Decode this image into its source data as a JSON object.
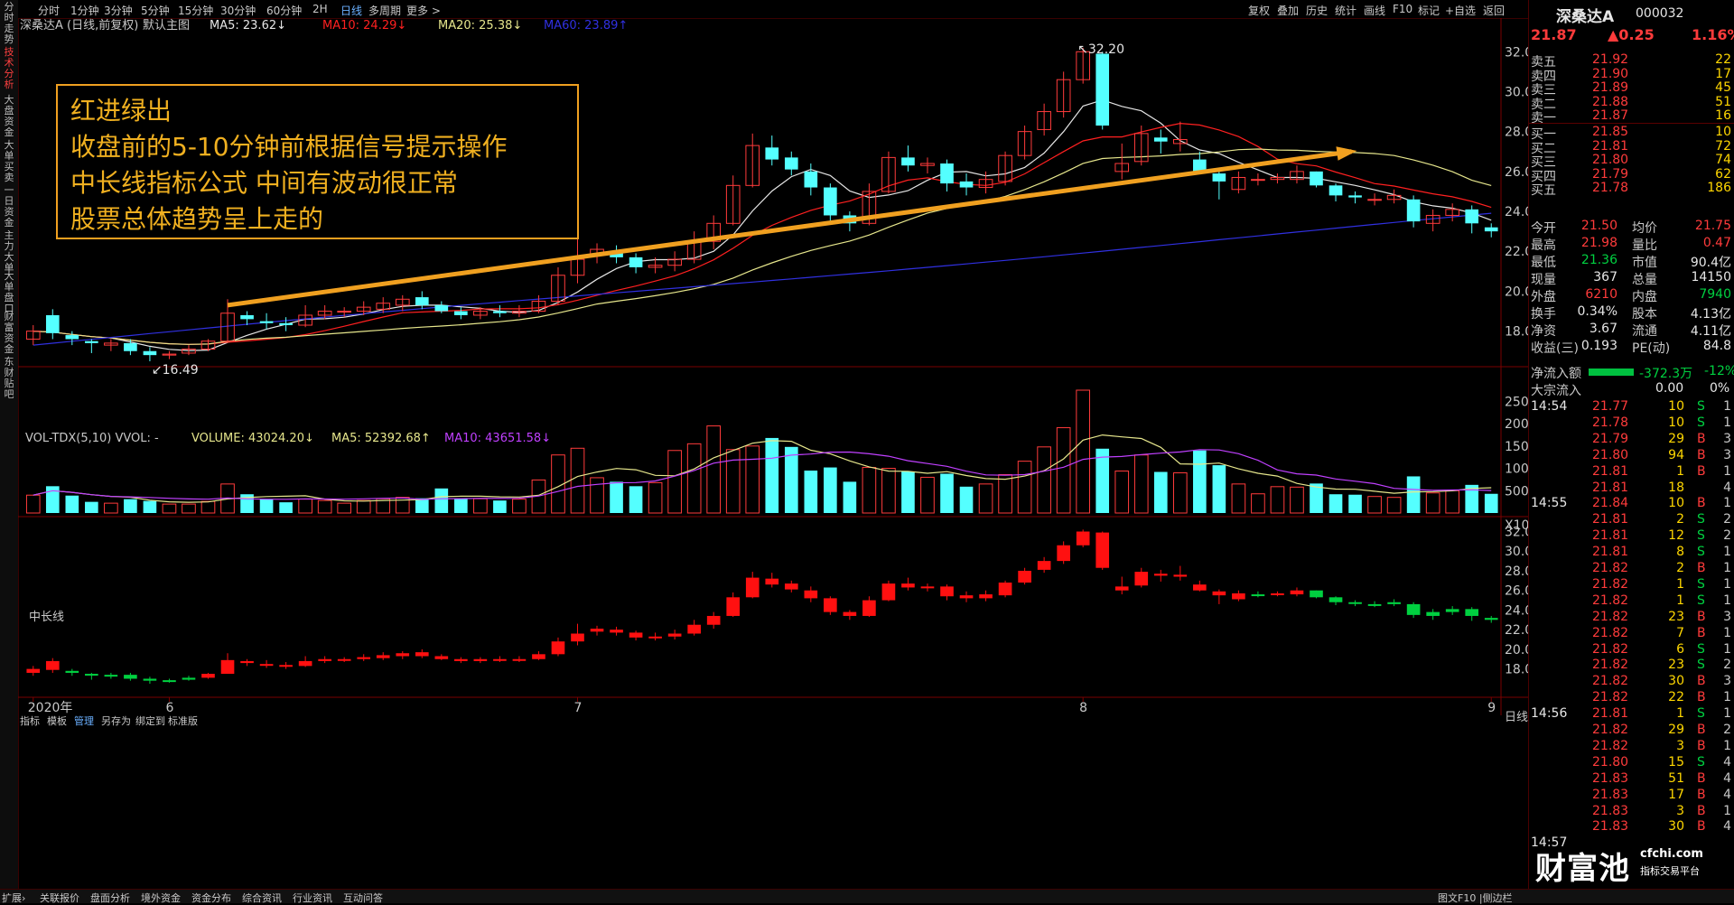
{
  "left_tabs": [
    "分时走势",
    "技术分析",
    "大盘资金",
    "大单买卖",
    "一日资金",
    "主力大单",
    "大单盘口",
    "财富资金",
    "东财贴吧"
  ],
  "period_tabs": [
    "分时",
    "1分钟",
    "3分钟",
    "5分钟",
    "15分钟",
    "30分钟",
    "60分钟",
    "2H",
    "日线",
    "多周期",
    "更多 >"
  ],
  "active_period": "日线",
  "toolbar_right": [
    "复权",
    "叠加",
    "历史",
    "统计",
    "画线",
    "F10",
    "标记",
    "+自选",
    "返回"
  ],
  "main_legend": {
    "stock": "深桑达A (日线,前复权)",
    "mode": "默认主图",
    "ma5": "MA5: 23.62↓",
    "ma10": "MA10: 24.29↓",
    "ma20": "MA20: 25.38↓",
    "ma60": "MA60: 23.89↑"
  },
  "vol_legend": {
    "name": "VOL-TDX(5,10) VVOL: -",
    "volume": "VOLUME: 43024.20↓",
    "ma5": "MA5: 52392.68↑",
    "ma10": "MA10: 43651.58↓"
  },
  "ind_legend": "中长线",
  "annotation": [
    "红进绿出",
    "收盘前的5-10分钟前根据信号提示操作",
    "中长线指标公式  中间有波动很正常",
    "股票总体趋势呈上走的"
  ],
  "price_ticks": [
    "32.00",
    "30.00",
    "28.00",
    "26.00",
    "24.00",
    "22.00",
    "20.00",
    "18.00"
  ],
  "vol_ticks": [
    "25000",
    "20000",
    "15000",
    "10000",
    "5000",
    "X10"
  ],
  "ind_ticks": [
    "32.00",
    "30.00",
    "28.00",
    "26.00",
    "24.00",
    "22.00",
    "20.00",
    "18.00"
  ],
  "x_labels": [
    "2020年",
    "6",
    "7",
    "8",
    "9"
  ],
  "high_label": "32.20",
  "low_label": "16.49",
  "quote": {
    "name": "深桑达A",
    "code": "000032",
    "price": "21.87",
    "change": "▲0.25",
    "pct": "1.16%",
    "asks": [
      {
        "l": "卖五",
        "p": "21.92",
        "v": "22"
      },
      {
        "l": "卖四",
        "p": "21.90",
        "v": "17"
      },
      {
        "l": "卖三",
        "p": "21.89",
        "v": "45"
      },
      {
        "l": "卖二",
        "p": "21.88",
        "v": "51"
      },
      {
        "l": "卖一",
        "p": "21.87",
        "v": "16"
      }
    ],
    "bids": [
      {
        "l": "买一",
        "p": "21.85",
        "v": "10"
      },
      {
        "l": "买二",
        "p": "21.81",
        "v": "72"
      },
      {
        "l": "买三",
        "p": "21.80",
        "v": "74"
      },
      {
        "l": "买四",
        "p": "21.79",
        "v": "62"
      },
      {
        "l": "买五",
        "p": "21.78",
        "v": "186"
      }
    ],
    "stats": [
      [
        "今开",
        "21.50",
        "均价",
        "21.75"
      ],
      [
        "最高",
        "21.98",
        "量比",
        "0.47"
      ],
      [
        "最低",
        "21.36",
        "市值",
        "90.4亿"
      ],
      [
        "现量",
        "367",
        "总量",
        "14150"
      ],
      [
        "外盘",
        "6210",
        "内盘",
        "7940"
      ],
      [
        "换手",
        "0.34%",
        "股本",
        "4.13亿"
      ],
      [
        "净资",
        "3.67",
        "流通",
        "4.11亿"
      ],
      [
        "收益(三)",
        "0.193",
        "PE(动)",
        "84.8"
      ]
    ],
    "netflow_label": "净流入额",
    "netflow_val": "-372.3万",
    "netflow_pct": "-12%",
    "block_label": "大宗流入",
    "block_val": "0.00",
    "block_pct": "0%"
  },
  "ticks": [
    {
      "t": "14:54",
      "p": "21.77",
      "v": "10",
      "s": "S",
      "n": "1"
    },
    {
      "t": "",
      "p": "21.78",
      "v": "10",
      "s": "S",
      "n": "1"
    },
    {
      "t": "",
      "p": "21.79",
      "v": "29",
      "s": "B",
      "n": "3"
    },
    {
      "t": "",
      "p": "21.80",
      "v": "94",
      "s": "B",
      "n": "3"
    },
    {
      "t": "",
      "p": "21.81",
      "v": "1",
      "s": "B",
      "n": "1"
    },
    {
      "t": "",
      "p": "21.81",
      "v": "18",
      "s": "",
      "n": "4"
    },
    {
      "t": "14:55",
      "p": "21.84",
      "v": "10",
      "s": "B",
      "n": "1"
    },
    {
      "t": "",
      "p": "21.81",
      "v": "2",
      "s": "S",
      "n": "2"
    },
    {
      "t": "",
      "p": "21.81",
      "v": "12",
      "s": "S",
      "n": "2"
    },
    {
      "t": "",
      "p": "21.81",
      "v": "8",
      "s": "S",
      "n": "1"
    },
    {
      "t": "",
      "p": "21.82",
      "v": "2",
      "s": "B",
      "n": "1"
    },
    {
      "t": "",
      "p": "21.82",
      "v": "1",
      "s": "S",
      "n": "1"
    },
    {
      "t": "",
      "p": "21.82",
      "v": "1",
      "s": "S",
      "n": "1"
    },
    {
      "t": "",
      "p": "21.82",
      "v": "23",
      "s": "B",
      "n": "3"
    },
    {
      "t": "",
      "p": "21.82",
      "v": "7",
      "s": "B",
      "n": "1"
    },
    {
      "t": "",
      "p": "21.82",
      "v": "6",
      "s": "S",
      "n": "1"
    },
    {
      "t": "",
      "p": "21.82",
      "v": "23",
      "s": "S",
      "n": "2"
    },
    {
      "t": "",
      "p": "21.82",
      "v": "30",
      "s": "B",
      "n": "3"
    },
    {
      "t": "",
      "p": "21.82",
      "v": "22",
      "s": "B",
      "n": "1"
    },
    {
      "t": "14:56",
      "p": "21.81",
      "v": "1",
      "s": "S",
      "n": "1"
    },
    {
      "t": "",
      "p": "21.82",
      "v": "29",
      "s": "B",
      "n": "2"
    },
    {
      "t": "",
      "p": "21.82",
      "v": "3",
      "s": "B",
      "n": "1"
    },
    {
      "t": "",
      "p": "21.80",
      "v": "15",
      "s": "S",
      "n": "4"
    },
    {
      "t": "",
      "p": "21.83",
      "v": "51",
      "s": "B",
      "n": "4"
    },
    {
      "t": "",
      "p": "21.83",
      "v": "17",
      "s": "B",
      "n": "4"
    },
    {
      "t": "",
      "p": "21.83",
      "v": "3",
      "s": "B",
      "n": "1"
    },
    {
      "t": "",
      "p": "21.83",
      "v": "30",
      "s": "B",
      "n": "4"
    },
    {
      "t": "14:57",
      "p": "",
      "v": "",
      "s": "",
      "n": ""
    }
  ],
  "bottom_left": [
    "指标",
    "模板",
    "管理",
    "另存为",
    "绑定到",
    "标准版"
  ],
  "bottom_status": [
    "扩展›",
    "关联报价",
    "盘面分析",
    "境外资金",
    "资金分布",
    "综合资讯",
    "行业资讯",
    "互动问答"
  ],
  "bottom_right_tab": "日线",
  "bottom_right_misc": "图文F10 |侧边栏",
  "logo": {
    "big": "财富池",
    "url": "cfchi.com",
    "sub": "指标交易平台"
  },
  "colors": {
    "up": "#ff3b3b",
    "down": "#54ffff",
    "ma5": "#e6e6e6",
    "ma10": "#ff2020",
    "ma20": "#e6e68c",
    "ma60": "#3030e0",
    "vol_ma5": "#e6e68c",
    "vol_ma10": "#c040ff",
    "ind_up": "#ff1010",
    "ind_down": "#00d040",
    "arrow": "#f0a020"
  },
  "chart_data": {
    "type": "candlestick",
    "title": "深桑达A (日线,前复权)",
    "series": [
      {
        "o": 17.6,
        "c": 18.0,
        "h": 18.3,
        "l": 17.3,
        "v": 4000
      },
      {
        "o": 18.8,
        "c": 17.9,
        "h": 19.1,
        "l": 17.6,
        "v": 6000
      },
      {
        "o": 17.8,
        "c": 17.6,
        "h": 18.0,
        "l": 17.3,
        "v": 3900
      },
      {
        "o": 17.5,
        "c": 17.4,
        "h": 17.6,
        "l": 16.9,
        "v": 2500
      },
      {
        "o": 17.3,
        "c": 17.4,
        "h": 17.6,
        "l": 17.0,
        "v": 2200
      },
      {
        "o": 17.4,
        "c": 17.0,
        "h": 17.6,
        "l": 16.8,
        "v": 3100
      },
      {
        "o": 17.0,
        "c": 16.8,
        "h": 17.2,
        "l": 16.49,
        "v": 2700
      },
      {
        "o": 16.8,
        "c": 16.85,
        "h": 17.0,
        "l": 16.6,
        "v": 2000
      },
      {
        "o": 16.9,
        "c": 17.1,
        "h": 17.3,
        "l": 16.8,
        "v": 2000
      },
      {
        "o": 17.1,
        "c": 17.5,
        "h": 17.6,
        "l": 17.0,
        "v": 2600
      },
      {
        "o": 17.5,
        "c": 18.9,
        "h": 19.6,
        "l": 17.5,
        "v": 6500
      },
      {
        "o": 18.8,
        "c": 18.6,
        "h": 19.0,
        "l": 18.3,
        "v": 4200
      },
      {
        "o": 18.5,
        "c": 18.4,
        "h": 18.9,
        "l": 18.1,
        "v": 3100
      },
      {
        "o": 18.4,
        "c": 18.3,
        "h": 18.7,
        "l": 18.0,
        "v": 2400
      },
      {
        "o": 18.3,
        "c": 18.8,
        "h": 19.3,
        "l": 18.2,
        "v": 3100
      },
      {
        "o": 18.8,
        "c": 19.0,
        "h": 19.3,
        "l": 18.6,
        "v": 2800
      },
      {
        "o": 19.0,
        "c": 19.0,
        "h": 19.2,
        "l": 18.7,
        "v": 2200
      },
      {
        "o": 19.0,
        "c": 19.2,
        "h": 19.5,
        "l": 18.8,
        "v": 2800
      },
      {
        "o": 19.1,
        "c": 19.4,
        "h": 19.7,
        "l": 18.9,
        "v": 3200
      },
      {
        "o": 19.3,
        "c": 19.6,
        "h": 19.8,
        "l": 19.0,
        "v": 3500
      },
      {
        "o": 19.7,
        "c": 19.3,
        "h": 20.0,
        "l": 19.1,
        "v": 3300
      },
      {
        "o": 19.3,
        "c": 19.0,
        "h": 19.5,
        "l": 18.9,
        "v": 5500
      },
      {
        "o": 19.0,
        "c": 18.8,
        "h": 19.2,
        "l": 18.6,
        "v": 3300
      },
      {
        "o": 18.8,
        "c": 19.0,
        "h": 19.2,
        "l": 18.6,
        "v": 3200
      },
      {
        "o": 19.0,
        "c": 18.9,
        "h": 19.3,
        "l": 18.7,
        "v": 2800
      },
      {
        "o": 18.9,
        "c": 19.0,
        "h": 19.3,
        "l": 18.7,
        "v": 3100
      },
      {
        "o": 19.0,
        "c": 19.5,
        "h": 19.8,
        "l": 18.9,
        "v": 7400
      },
      {
        "o": 19.5,
        "c": 20.8,
        "h": 21.2,
        "l": 19.3,
        "v": 13000
      },
      {
        "o": 20.8,
        "c": 21.6,
        "h": 22.6,
        "l": 20.4,
        "v": 14500
      },
      {
        "o": 21.8,
        "c": 22.1,
        "h": 22.4,
        "l": 21.4,
        "v": 7900
      },
      {
        "o": 22.0,
        "c": 21.7,
        "h": 22.3,
        "l": 21.4,
        "v": 7000
      },
      {
        "o": 21.7,
        "c": 21.2,
        "h": 21.9,
        "l": 20.9,
        "v": 6000
      },
      {
        "o": 21.2,
        "c": 21.3,
        "h": 21.7,
        "l": 20.9,
        "v": 6800
      },
      {
        "o": 21.3,
        "c": 21.6,
        "h": 22.0,
        "l": 21.0,
        "v": 14000
      },
      {
        "o": 21.6,
        "c": 22.5,
        "h": 23.0,
        "l": 21.4,
        "v": 15500
      },
      {
        "o": 22.5,
        "c": 23.4,
        "h": 23.8,
        "l": 22.1,
        "v": 19500
      },
      {
        "o": 23.4,
        "c": 25.3,
        "h": 25.8,
        "l": 23.3,
        "v": 14200
      },
      {
        "o": 25.3,
        "c": 27.3,
        "h": 27.9,
        "l": 25.2,
        "v": 15000
      },
      {
        "o": 27.2,
        "c": 26.6,
        "h": 27.8,
        "l": 26.3,
        "v": 16800
      },
      {
        "o": 26.7,
        "c": 26.1,
        "h": 27.0,
        "l": 25.8,
        "v": 14800
      },
      {
        "o": 26.0,
        "c": 25.2,
        "h": 26.4,
        "l": 24.8,
        "v": 9500
      },
      {
        "o": 25.2,
        "c": 23.8,
        "h": 25.4,
        "l": 23.5,
        "v": 10200
      },
      {
        "o": 23.8,
        "c": 23.4,
        "h": 24.0,
        "l": 23.0,
        "v": 7000
      },
      {
        "o": 23.4,
        "c": 25.0,
        "h": 25.4,
        "l": 23.3,
        "v": 10200
      },
      {
        "o": 25.0,
        "c": 26.7,
        "h": 27.0,
        "l": 24.9,
        "v": 10000
      },
      {
        "o": 26.7,
        "c": 26.3,
        "h": 27.3,
        "l": 26.0,
        "v": 9300
      },
      {
        "o": 26.3,
        "c": 26.4,
        "h": 26.7,
        "l": 25.9,
        "v": 8000
      },
      {
        "o": 26.4,
        "c": 25.4,
        "h": 26.6,
        "l": 25.0,
        "v": 8800
      },
      {
        "o": 25.5,
        "c": 25.2,
        "h": 25.9,
        "l": 24.8,
        "v": 5900
      },
      {
        "o": 25.2,
        "c": 25.6,
        "h": 26.0,
        "l": 24.9,
        "v": 6500
      },
      {
        "o": 25.5,
        "c": 26.8,
        "h": 27.0,
        "l": 25.3,
        "v": 8600
      },
      {
        "o": 26.8,
        "c": 28.0,
        "h": 28.3,
        "l": 26.6,
        "v": 11600
      },
      {
        "o": 28.1,
        "c": 29.0,
        "h": 29.4,
        "l": 27.8,
        "v": 14800
      },
      {
        "o": 29.0,
        "c": 30.6,
        "h": 31.0,
        "l": 28.7,
        "v": 19100
      },
      {
        "o": 30.6,
        "c": 32.0,
        "h": 32.2,
        "l": 30.4,
        "v": 27500
      },
      {
        "o": 31.9,
        "c": 28.3,
        "h": 32.0,
        "l": 28.1,
        "v": 14400
      },
      {
        "o": 26.0,
        "c": 26.4,
        "h": 27.4,
        "l": 25.6,
        "v": 9400
      },
      {
        "o": 26.5,
        "c": 27.9,
        "h": 28.3,
        "l": 26.3,
        "v": 13000
      },
      {
        "o": 27.7,
        "c": 27.5,
        "h": 28.1,
        "l": 26.9,
        "v": 9200
      },
      {
        "o": 27.4,
        "c": 27.6,
        "h": 28.5,
        "l": 27.0,
        "v": 9000
      },
      {
        "o": 26.6,
        "c": 26.0,
        "h": 27.0,
        "l": 25.9,
        "v": 14000
      },
      {
        "o": 25.9,
        "c": 25.5,
        "h": 26.1,
        "l": 24.6,
        "v": 10700
      },
      {
        "o": 25.1,
        "c": 25.7,
        "h": 26.0,
        "l": 24.9,
        "v": 6500
      },
      {
        "o": 25.6,
        "c": 25.6,
        "h": 25.9,
        "l": 25.3,
        "v": 4300
      },
      {
        "o": 25.6,
        "c": 25.7,
        "h": 25.9,
        "l": 25.4,
        "v": 5900
      },
      {
        "o": 25.6,
        "c": 26.0,
        "h": 26.3,
        "l": 25.4,
        "v": 5800
      },
      {
        "o": 26.0,
        "c": 25.3,
        "h": 26.0,
        "l": 25.2,
        "v": 6600
      },
      {
        "o": 25.3,
        "c": 24.8,
        "h": 25.4,
        "l": 24.5,
        "v": 4200
      },
      {
        "o": 24.8,
        "c": 24.7,
        "h": 25.0,
        "l": 24.4,
        "v": 4100
      },
      {
        "o": 24.6,
        "c": 24.6,
        "h": 24.9,
        "l": 24.3,
        "v": 3700
      },
      {
        "o": 24.6,
        "c": 24.8,
        "h": 25.1,
        "l": 24.4,
        "v": 3500
      },
      {
        "o": 24.6,
        "c": 23.5,
        "h": 24.8,
        "l": 23.2,
        "v": 8200
      },
      {
        "o": 23.4,
        "c": 23.8,
        "h": 24.1,
        "l": 23.0,
        "v": 4500
      },
      {
        "o": 23.8,
        "c": 24.1,
        "h": 24.4,
        "l": 23.5,
        "v": 5000
      },
      {
        "o": 24.1,
        "c": 23.4,
        "h": 24.3,
        "l": 22.9,
        "v": 6300
      },
      {
        "o": 23.2,
        "c": 23.0,
        "h": 23.4,
        "l": 22.7,
        "v": 4300
      }
    ],
    "ylim": [
      16.4,
      32.6
    ],
    "vol_ylim": [
      0,
      27500
    ],
    "x_label_index": {
      "2020年": 0,
      "6": 7,
      "7": 28,
      "8": 54,
      "9": 75
    }
  }
}
